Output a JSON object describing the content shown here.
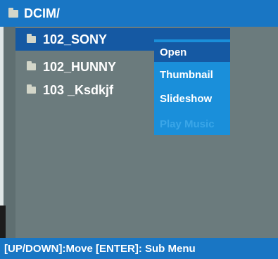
{
  "header": {
    "title": "DCIM/",
    "icon": "folder-icon"
  },
  "folders": [
    {
      "label": "102_SONY",
      "icon": "folder-icon",
      "selected": true
    },
    {
      "label": "102_HUNNY",
      "icon": "folder-icon",
      "selected": false
    },
    {
      "label": "103 _Ksdkjf",
      "icon": "folder-icon",
      "selected": false
    }
  ],
  "context_menu": {
    "items": [
      {
        "label": "Open",
        "state": "highlighted"
      },
      {
        "label": "Thumbnail",
        "state": "enabled"
      },
      {
        "label": "Slideshow",
        "state": "enabled"
      },
      {
        "label": "Play Music",
        "state": "disabled"
      }
    ]
  },
  "footer": {
    "hint": "[UP/DOWN]:Move [ENTER]: Sub Menu"
  },
  "colors": {
    "bar_blue": "#1976c4",
    "selection_blue": "#1559a3",
    "menu_blue": "#1a8fda",
    "background": "#6b7b7d"
  }
}
